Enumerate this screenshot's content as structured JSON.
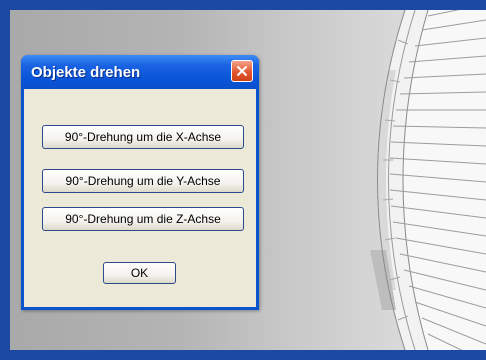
{
  "dialog": {
    "title": "Objekte drehen",
    "buttons": {
      "rotate_x": "90°-Drehung um die X-Achse",
      "rotate_y": "90°-Drehung um die Y-Achse",
      "rotate_z": "90°-Drehung um die Z-Achse",
      "ok": "OK"
    }
  },
  "colors": {
    "desktop": "#1c4aa3",
    "titlebar": "#0a55d8",
    "dialog_body": "#ece9d8",
    "close_button": "#e3562f"
  }
}
